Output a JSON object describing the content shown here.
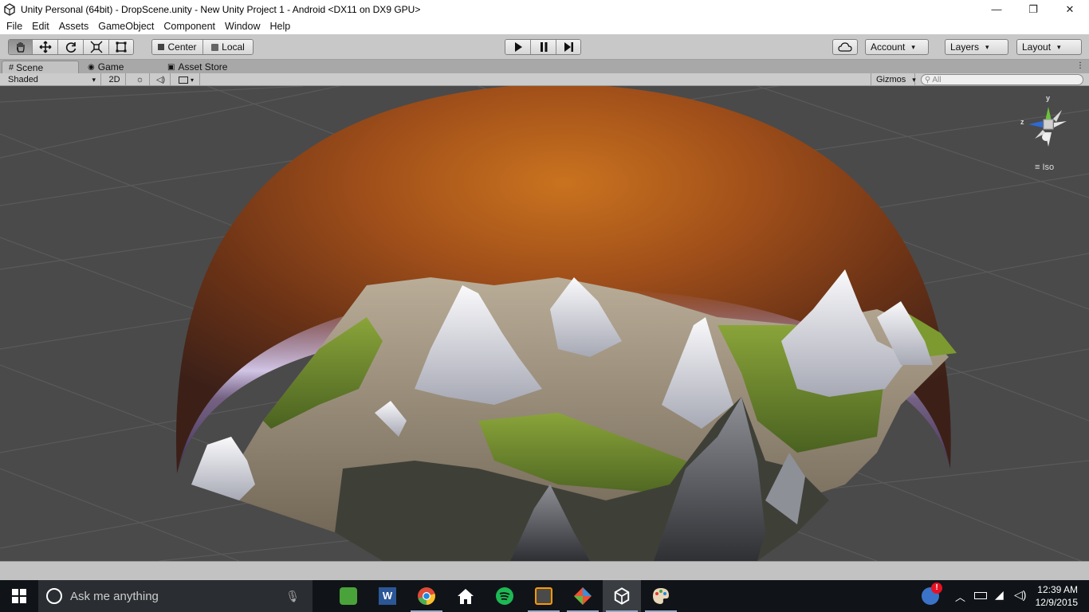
{
  "window": {
    "title": "Unity Personal (64bit) - DropScene.unity - New Unity Project 1 - Android <DX11 on DX9 GPU>",
    "minimize": "—",
    "maximize": "❐",
    "close": "✕"
  },
  "menu": [
    "File",
    "Edit",
    "Assets",
    "GameObject",
    "Component",
    "Window",
    "Help"
  ],
  "toolbar": {
    "pivot_label": "Center",
    "space_label": "Local",
    "account_label": "Account",
    "layers_label": "Layers",
    "layout_label": "Layout"
  },
  "tabs": {
    "scene": "Scene",
    "game": "Game",
    "asset_store": "Asset Store"
  },
  "scenebar": {
    "shading_mode": "Shaded",
    "mode_2d": "2D",
    "gizmos": "Gizmos",
    "search_placeholder": "All"
  },
  "gizmo": {
    "y": "y",
    "z": "z",
    "projection": "Iso"
  },
  "taskbar": {
    "search_placeholder": "Ask me anything",
    "time": "12:39 AM",
    "date": "12/9/2015"
  },
  "colors": {
    "sky_top": "#6b2f10",
    "sky_mid": "#b55a1c",
    "horizon": "#c9b8e6",
    "grass": "#6f8a2a",
    "rock": "#a59c8c",
    "snow": "#e6e6ec",
    "viewport_bg": "#4a4a4a"
  }
}
